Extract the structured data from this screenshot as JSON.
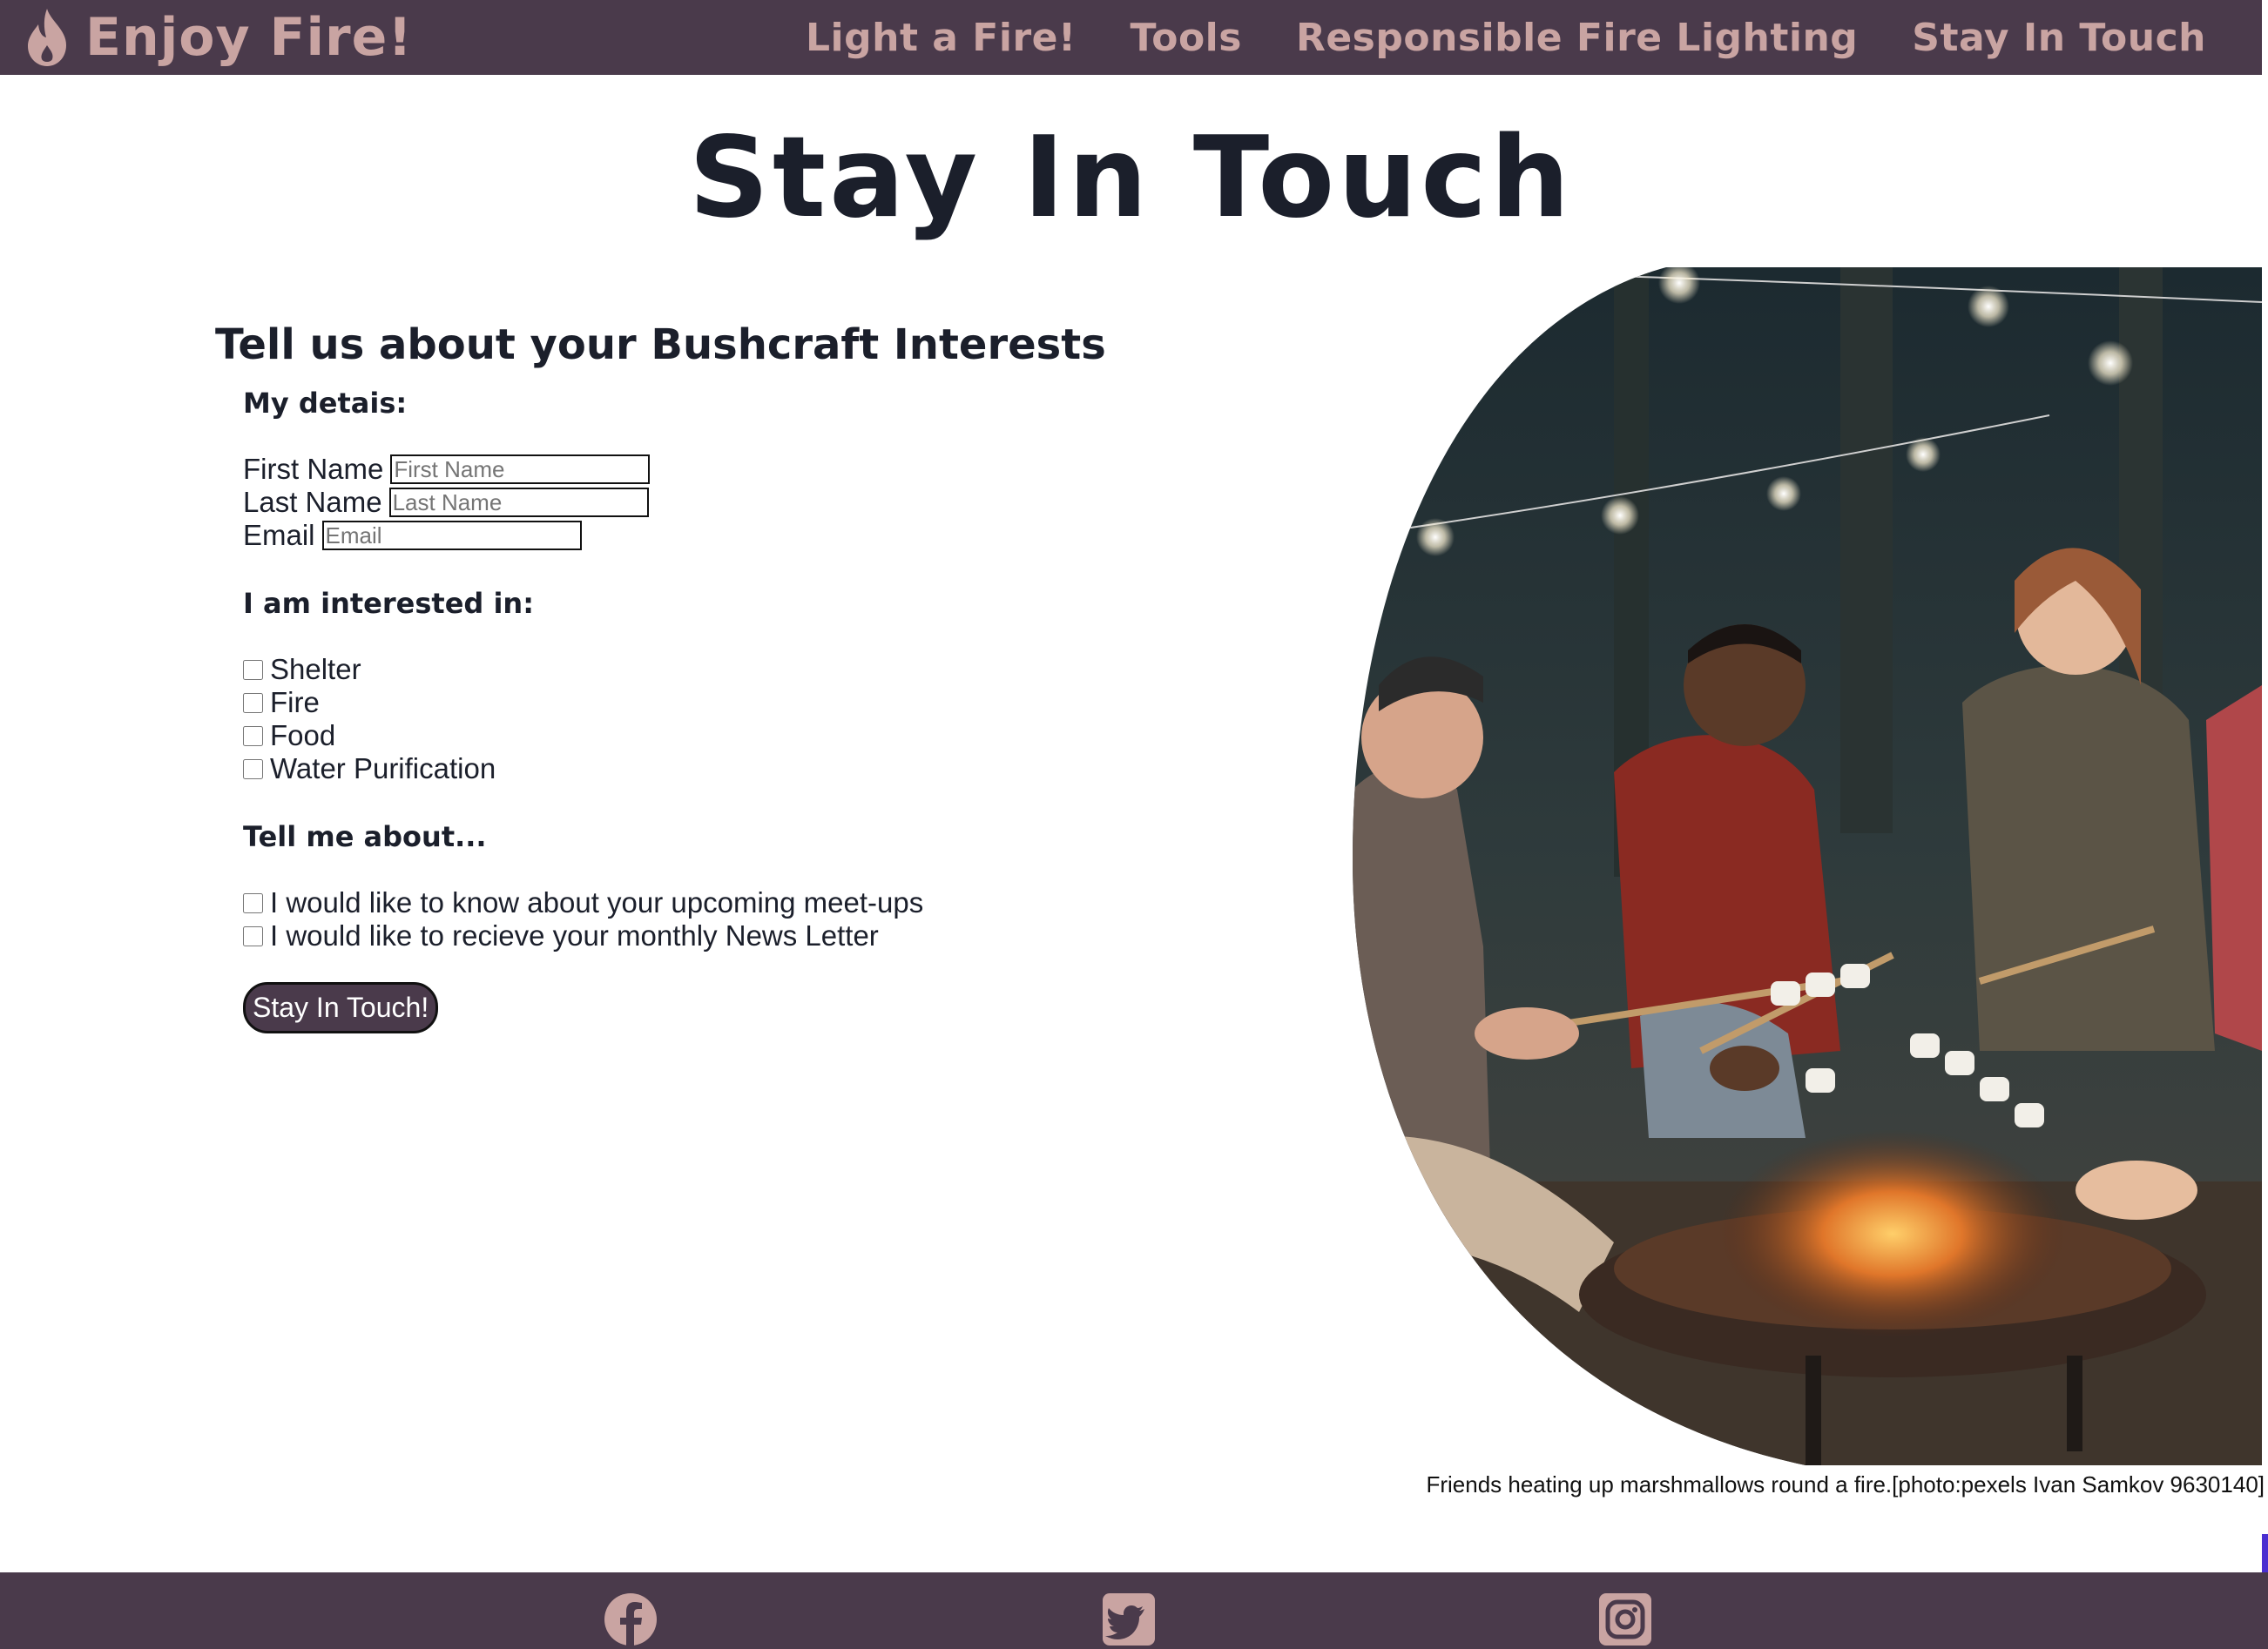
{
  "header": {
    "brand": "Enjoy Fire!",
    "nav": [
      "Light a Fire!",
      "Tools",
      "Responsible Fire Lighting",
      "Stay In Touch"
    ]
  },
  "page": {
    "title": "Stay In Touch"
  },
  "form": {
    "heading": "Tell us about your Bushcraft Interests",
    "details_label": "My detais:",
    "fields": [
      {
        "label": "First Name",
        "placeholder": "First Name"
      },
      {
        "label": "Last Name",
        "placeholder": "Last Name"
      },
      {
        "label": "Email",
        "placeholder": "Email"
      }
    ],
    "interests_label": "I am interested in:",
    "interests": [
      "Shelter",
      "Fire",
      "Food",
      "Water Purification"
    ],
    "tell_label": "Tell me about...",
    "tell_options": [
      "I would like to know about your upcoming meet-ups",
      "I would like to recieve your monthly News Letter"
    ],
    "submit": "Stay In Touch!"
  },
  "figure": {
    "caption": "Friends heating up marshmallows round a fire.[photo:pexels Ivan Samkov 9630140]"
  },
  "footer": {
    "icons": [
      "facebook-icon",
      "twitter-icon",
      "instagram-icon"
    ]
  },
  "colors": {
    "header_bg": "#4a3a4b",
    "nav_text": "#c9a4a2",
    "heading_text": "#1b1f2b",
    "button_bg": "#4a3a4b"
  }
}
